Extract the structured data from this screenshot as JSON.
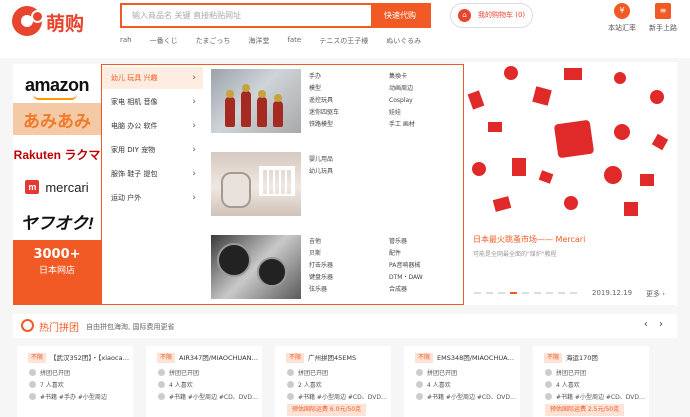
{
  "header": {
    "logo_text": "萌购",
    "search_placeholder": "输入商品名 关键 直接粘贴网址",
    "search_button": "快速代购",
    "hot_words": [
      "rah",
      "一番くじ",
      "たまごっち",
      "海洋堂",
      "fate",
      "テニスの王子様",
      "ぬいぐるみ"
    ],
    "cart_label": "我的购物车 (0)",
    "tools": [
      {
        "icon": "¥",
        "label": "本站汇率"
      },
      {
        "icon": "≡",
        "label": "新手上路"
      }
    ]
  },
  "brands": {
    "amazon": "amazon",
    "amiami": "あみあみ",
    "rakuten": "Rakuten ラクマ",
    "mercari": "mercari",
    "mercari_mark": "m",
    "yahoo": "ヤフオク!",
    "cta_big": "3000+",
    "cta_small": "日本网店"
  },
  "categories": [
    {
      "label": "幼儿 玩具 兴趣",
      "arrow": "›"
    },
    {
      "label": "家电 相机 音像",
      "arrow": "›"
    },
    {
      "label": "电脑 办公 软件",
      "arrow": "›"
    },
    {
      "label": "家用 DIY 宠物",
      "arrow": "›"
    },
    {
      "label": "服饰 鞋子 提包",
      "arrow": "›"
    },
    {
      "label": "运动 户外",
      "arrow": "›"
    }
  ],
  "flyout": {
    "group1_col1": [
      "手办",
      "模型",
      "遥控玩具",
      "迷你四驱车",
      "铁路模型"
    ],
    "group1_col2": [
      "集換卡",
      "动画周边",
      "Cosplay",
      "娃娃",
      "手工 画材"
    ],
    "group2_col1": [
      "婴儿用品",
      "幼儿玩具"
    ],
    "group3_col1": [
      "吉他",
      "贝斯",
      "打击乐器",
      "键盘乐器",
      "弦乐器"
    ],
    "group3_col2": [
      "管乐器",
      "配件",
      "PA音响器械",
      "DTM・DAW",
      "合成器"
    ]
  },
  "banner": {
    "title": "日本最火跳蚤市场—— Mercari",
    "subtitle": "可能是全网最全面的\"煤炉\"教程",
    "date": "2019.12.19",
    "more": "更多 ›",
    "accent": "#e02a2a"
  },
  "section": {
    "title": "热门拼团",
    "subtitle": "自由拼包海淘, 国际费用更省",
    "nav": "‹ ›"
  },
  "products": [
    {
      "tag": "不限",
      "title": "【武汉352团】・【xiaocao…",
      "status": "拼团已开团",
      "likes": "7 人喜欢",
      "tags": "#书籍 #手办 #小型周边",
      "badge": ""
    },
    {
      "tag": "不限",
      "title": "AIR347团/MIAOCHUAN全…",
      "status": "拼团已开团",
      "likes": "4 人喜欢",
      "tags": "#书籍 #小型周边 #CD、DVD…",
      "badge": ""
    },
    {
      "tag": "不限",
      "title": "广州拼团45EMS",
      "status": "拼团已开团",
      "likes": "2 人喜欢",
      "tags": "#书籍 #小型周边 #CD、DVD…",
      "badge": "预估国际运费 6.0元/50克"
    },
    {
      "tag": "不限",
      "title": "EMS348团/MIAOCHUAN…",
      "status": "拼团已开团",
      "likes": "4 人喜欢",
      "tags": "#书籍 #小型周边 #CD、DVD…",
      "badge": ""
    },
    {
      "tag": "不限",
      "title": "海运170团",
      "status": "拼团已开团",
      "likes": "4 人喜欢",
      "tags": "#书籍 #小型周边 #CD、DVD…",
      "badge": "预估国际运费 2.5元/50克"
    }
  ],
  "colors": {
    "brand": "#f15a24",
    "accent": "#e8452f",
    "background": "#f6f6f6"
  }
}
